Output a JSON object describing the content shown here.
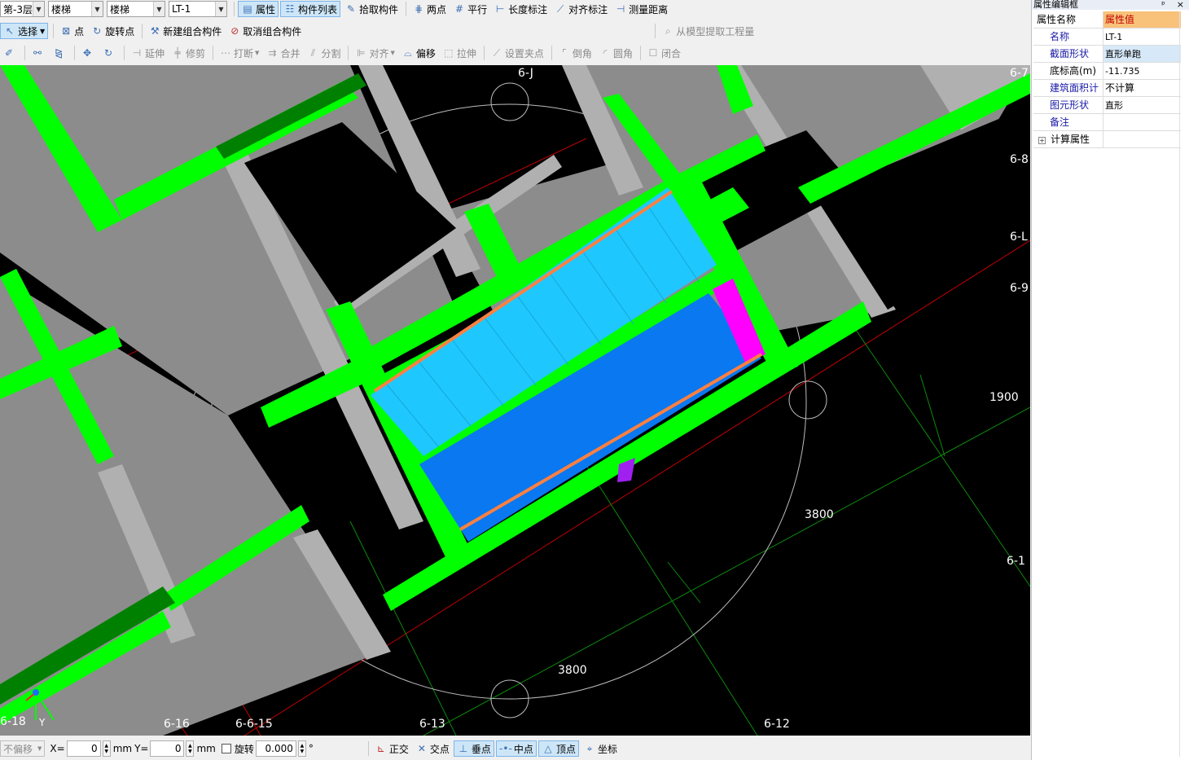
{
  "toolbar1": {
    "floor": "第-3层",
    "category": "楼梯",
    "subtype": "楼梯",
    "component": "LT-1",
    "buttons": [
      "属性",
      "构件列表",
      "拾取构件",
      "两点",
      "平行",
      "长度标注",
      "对齐标注",
      "测量距离"
    ]
  },
  "toolbar2": {
    "select": "选择",
    "buttons": [
      "点",
      "旋转点",
      "新建组合构件",
      "取消组合构件"
    ],
    "extract": "从模型提取工程量"
  },
  "toolbar3": {
    "buttons": [
      "延伸",
      "修剪",
      "打断",
      "合并",
      "分割",
      "对齐",
      "偏移",
      "拉伸",
      "设置夹点",
      "倒角",
      "圆角",
      "闭合"
    ]
  },
  "canvas": {
    "axis_labels": [
      "6-J",
      "6-7",
      "6-8",
      "6-L",
      "6-9",
      "6-1",
      "6-18",
      "6-16",
      "6-6-15",
      "6-13",
      "6-12"
    ],
    "dimensions": [
      "1900",
      "3800",
      "3800"
    ],
    "ucs_y": "Y",
    "colors": {
      "background": "#000000",
      "wall": "#00ff00",
      "dark_wall": "#008000",
      "slab": "#808080",
      "beam": "#a9a9a9",
      "stair_light": "#1ec8ff",
      "stair_dark": "#0a78f0",
      "railing": "#ff8040",
      "magenta": "#ff00ff",
      "axis_red": "#c00000"
    }
  },
  "status": {
    "offset": "不偏移",
    "x_label": "X=",
    "x_value": "0",
    "unit1": "mm",
    "y_label": "Y=",
    "y_value": "0",
    "unit2": "mm",
    "rotate": "旋转",
    "angle": "0.000",
    "degree": "°",
    "snaps": [
      "正交",
      "交点",
      "垂点",
      "中点",
      "顶点",
      "坐标"
    ]
  },
  "panel": {
    "title": "属性编辑框",
    "pin": "ᵖ",
    "close": "×",
    "header_name": "属性名称",
    "header_value": "属性值",
    "rows": [
      {
        "k": "名称",
        "v": "LT-1"
      },
      {
        "k": "截面形状",
        "v": "直形单跑"
      },
      {
        "k": "底标高(m)",
        "v": "-11.735"
      },
      {
        "k": "建筑面积计",
        "v": "不计算"
      },
      {
        "k": "图元形状",
        "v": "直形"
      },
      {
        "k": "备注",
        "v": ""
      }
    ],
    "calc": "计算属性",
    "expand": "+"
  }
}
